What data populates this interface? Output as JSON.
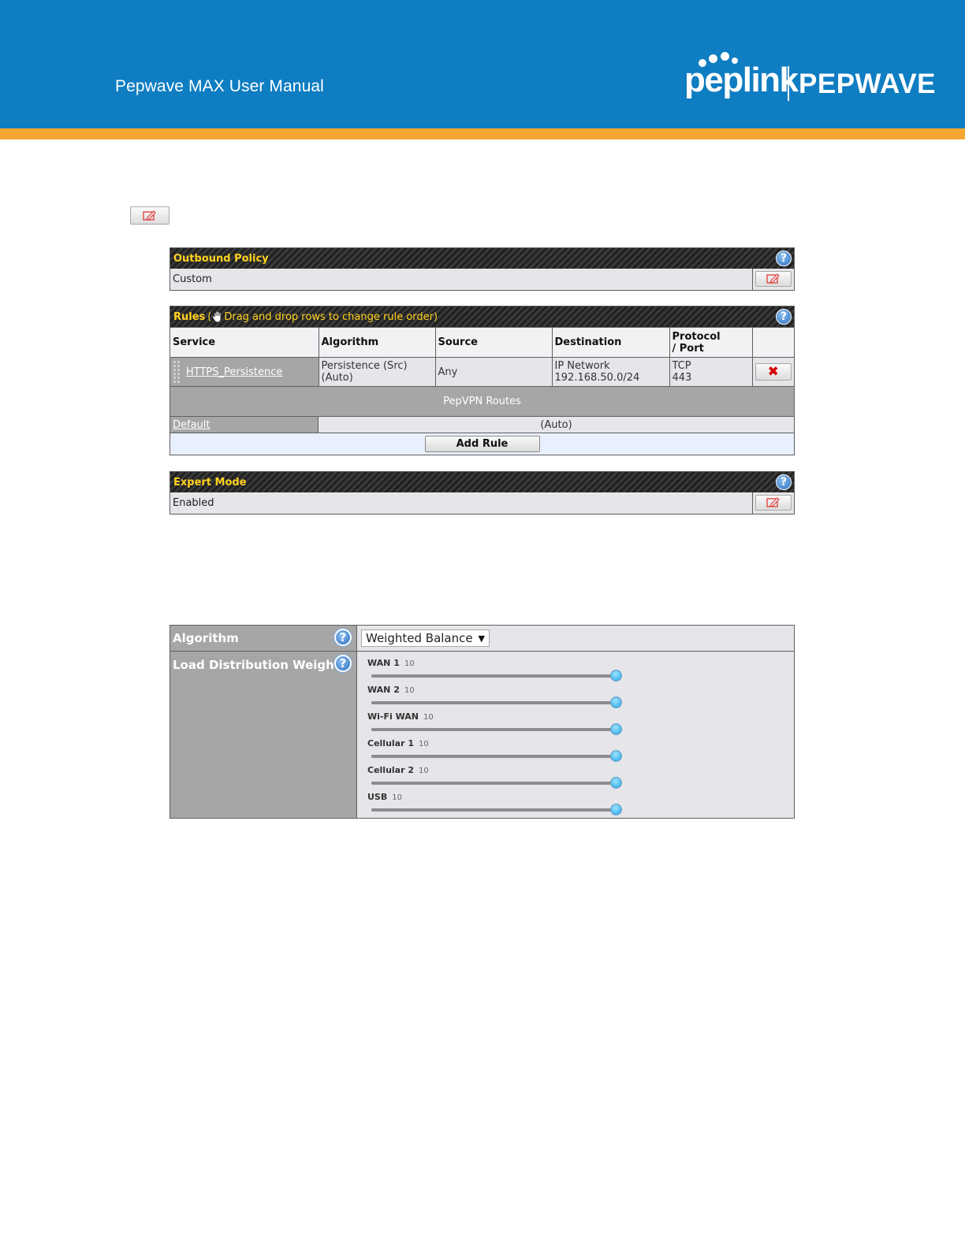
{
  "header": {
    "manual_title": "Pepwave MAX User Manual",
    "logo_left": "peplink",
    "logo_right": "PEPWAVE",
    "colors": {
      "banner": "#0e7dc2",
      "stripe": "#f7a731"
    }
  },
  "icons": {
    "edit": "edit-icon",
    "help": "help-icon",
    "delete": "delete-icon",
    "drag": "drag-hand-icon",
    "help_glyph": "?",
    "delete_glyph": "✖"
  },
  "outbound_policy": {
    "title": "Outbound Policy",
    "value": "Custom"
  },
  "rules": {
    "title": "Rules",
    "hint": "Drag and drop rows to change rule order",
    "paren_open": "(",
    "paren_close": ")",
    "columns": [
      "Service",
      "Algorithm",
      "Source",
      "Destination",
      "Protocol",
      "/ Port"
    ],
    "rows": [
      {
        "service": "HTTPS_Persistence",
        "algorithm_line1": "Persistence (Src)",
        "algorithm_line2": "(Auto)",
        "source": "Any",
        "destination_line1": "IP Network",
        "destination_line2": "192.168.50.0/24",
        "protocol_line1": "TCP",
        "protocol_line2": "443"
      }
    ],
    "pepvpn_routes": "PepVPN Routes",
    "default_label": "Default",
    "default_value": "(Auto)",
    "add_rule": "Add Rule"
  },
  "expert_mode": {
    "title": "Expert Mode",
    "value": "Enabled"
  },
  "algorithm": {
    "label": "Algorithm",
    "selected": "Weighted Balance"
  },
  "load_distribution": {
    "label": "Load Distribution Weight",
    "sliders": [
      {
        "name": "WAN 1",
        "value": "10",
        "level": 1.0
      },
      {
        "name": "WAN 2",
        "value": "10",
        "level": 1.0
      },
      {
        "name": "Wi-Fi WAN",
        "value": "10",
        "level": 1.0
      },
      {
        "name": "Cellular 1",
        "value": "10",
        "level": 1.0
      },
      {
        "name": "Cellular 2",
        "value": "10",
        "level": 1.0
      },
      {
        "name": "USB",
        "value": "10",
        "level": 1.0
      }
    ]
  }
}
